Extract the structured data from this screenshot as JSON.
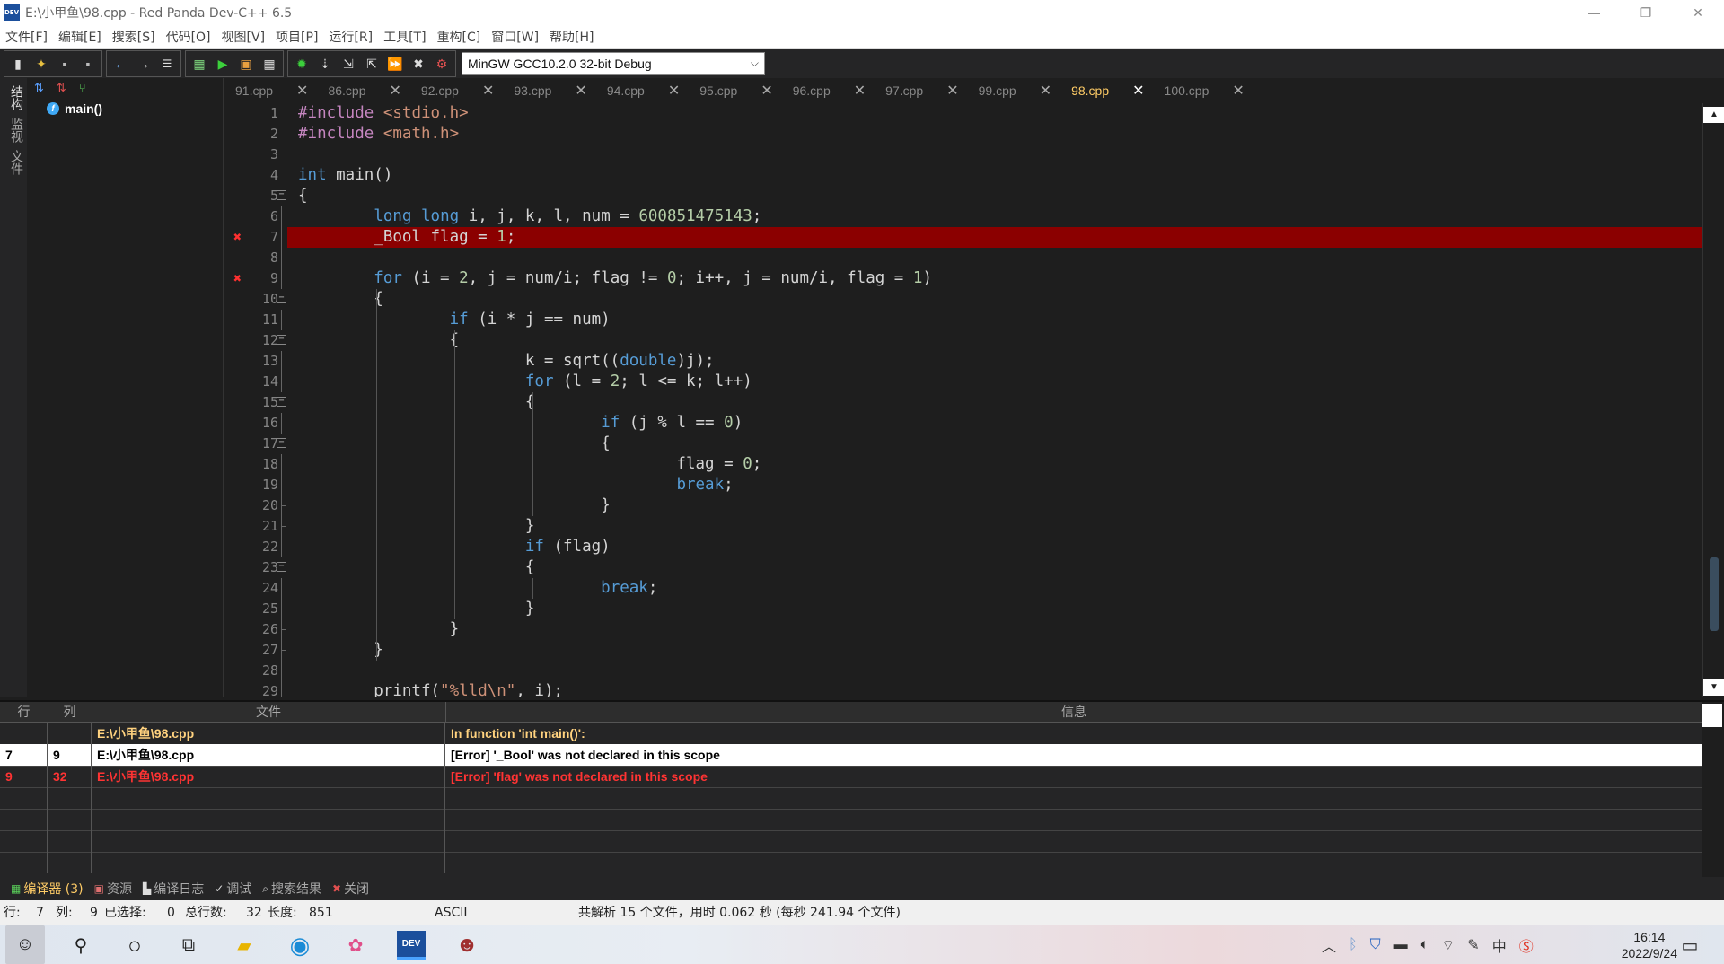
{
  "window": {
    "title": "E:\\小甲鱼\\98.cpp - Red Panda Dev-C++ 6.5",
    "app_icon": "DEV",
    "buttons": [
      "—",
      "❐",
      "✕"
    ]
  },
  "menu": [
    "文件[F]",
    "编辑[E]",
    "搜索[S]",
    "代码[O]",
    "视图[V]",
    "项目[P]",
    "运行[R]",
    "工具[T]",
    "重构[C]",
    "窗口[W]",
    "帮助[H]"
  ],
  "toolbar": {
    "compiler": "MinGW GCC10.2.0 32-bit Debug"
  },
  "left_strip": [
    "结构",
    "监视",
    "文件"
  ],
  "structure": {
    "item": "main()",
    "badge": "f"
  },
  "tabs": [
    {
      "label": "91.cpp",
      "active": false
    },
    {
      "label": "86.cpp",
      "active": false
    },
    {
      "label": "92.cpp",
      "active": false
    },
    {
      "label": "93.cpp",
      "active": false
    },
    {
      "label": "94.cpp",
      "active": false
    },
    {
      "label": "95.cpp",
      "active": false
    },
    {
      "label": "96.cpp",
      "active": false
    },
    {
      "label": "97.cpp",
      "active": false
    },
    {
      "label": "99.cpp",
      "active": false
    },
    {
      "label": "98.cpp",
      "active": true
    },
    {
      "label": "100.cpp",
      "active": false
    }
  ],
  "code_lines": [
    {
      "n": "1",
      "text": "#include <stdio.h>"
    },
    {
      "n": "2",
      "text": "#include <math.h>"
    },
    {
      "n": "3",
      "text": ""
    },
    {
      "n": "4",
      "text": "int main()"
    },
    {
      "n": "5",
      "text": "{"
    },
    {
      "n": "6",
      "text": "        long long i, j, k, l, num = 600851475143;"
    },
    {
      "n": "7",
      "text": "        _Bool flag = 1;"
    },
    {
      "n": "8",
      "text": ""
    },
    {
      "n": "9",
      "text": "        for (i = 2, j = num/i; flag != 0; i++, j = num/i, flag = 1)"
    },
    {
      "n": "10",
      "text": "        {"
    },
    {
      "n": "11",
      "text": "                if (i * j == num)"
    },
    {
      "n": "12",
      "text": "                {"
    },
    {
      "n": "13",
      "text": "                        k = sqrt((double)j);"
    },
    {
      "n": "14",
      "text": "                        for (l = 2; l <= k; l++)"
    },
    {
      "n": "15",
      "text": "                        {"
    },
    {
      "n": "16",
      "text": "                                if (j % l == 0)"
    },
    {
      "n": "17",
      "text": "                                {"
    },
    {
      "n": "18",
      "text": "                                        flag = 0;"
    },
    {
      "n": "19",
      "text": "                                        break;"
    },
    {
      "n": "20",
      "text": "                                }"
    },
    {
      "n": "21",
      "text": "                        }"
    },
    {
      "n": "22",
      "text": "                        if (flag)"
    },
    {
      "n": "23",
      "text": "                        {"
    },
    {
      "n": "24",
      "text": "                                break;"
    },
    {
      "n": "25",
      "text": "                        }"
    },
    {
      "n": "26",
      "text": "                }"
    },
    {
      "n": "27",
      "text": "        }"
    },
    {
      "n": "28",
      "text": ""
    },
    {
      "n": "29",
      "text": "        printf(\"%lld\\n\", i);"
    }
  ],
  "messages": {
    "headers": {
      "row": "行",
      "col": "列",
      "file": "文件",
      "info": "信息"
    },
    "rows": [
      {
        "row": "",
        "col": "",
        "file": "E:\\小甲鱼\\98.cpp",
        "info": "In function 'int main()':"
      },
      {
        "row": "7",
        "col": "9",
        "file": "E:\\小甲鱼\\98.cpp",
        "info": "[Error] '_Bool' was not declared in this scope"
      },
      {
        "row": "9",
        "col": "32",
        "file": "E:\\小甲鱼\\98.cpp",
        "info": "[Error] 'flag' was not declared in this scope"
      }
    ]
  },
  "bottom_tabs": [
    "编译器 (3)",
    "资源",
    "编译日志",
    "调试",
    "搜索结果",
    "关闭"
  ],
  "status": {
    "row_label": "行:",
    "row": "7",
    "col_label": "列:",
    "col": "9",
    "sel_label": "已选择:",
    "sel": "0",
    "lines_label": "总行数:",
    "lines": "32",
    "len_label": "长度:",
    "len": "851",
    "encoding": "ASCII",
    "parse_msg": "共解析 15 个文件，用时 0.062 秒 (每秒 241.94 个文件)"
  },
  "taskbar": {
    "time": "16:14",
    "date": "2022/9/24",
    "dev_label": "DEV",
    "tray_ime": "中"
  },
  "colors": {
    "error_line": "#8b0000",
    "active_tab": "#ffcc66",
    "keyword": "#569cd6"
  }
}
